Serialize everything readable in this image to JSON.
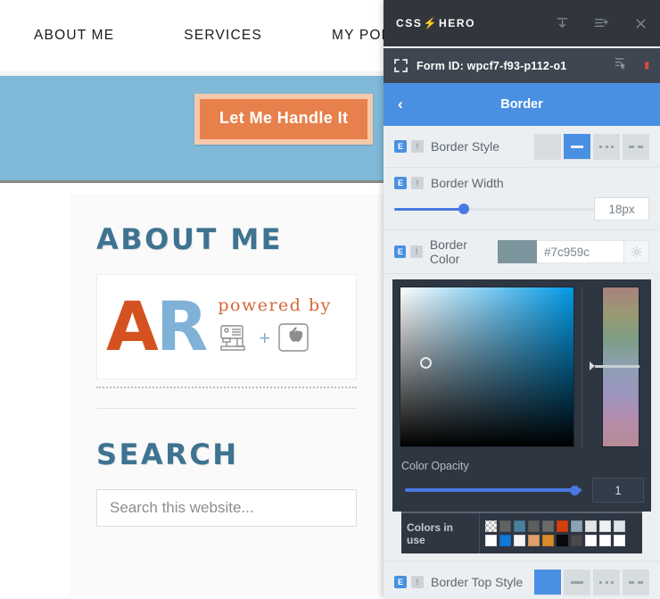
{
  "site": {
    "nav": [
      {
        "label": "ABOUT ME"
      },
      {
        "label": "SERVICES"
      },
      {
        "label": "MY PORTFOLIO"
      }
    ],
    "banner": {
      "cta_label": "Let Me Handle It",
      "bg_color": "#80bad8",
      "cta_color": "#e8804c"
    },
    "widgets": {
      "about": {
        "title": "ABOUT ME",
        "logo_a": "A",
        "logo_r": "R",
        "powered_by": "powered by",
        "plus": "+"
      },
      "search": {
        "title": "SEARCH",
        "placeholder": "Search this website...",
        "value": ""
      }
    }
  },
  "panel": {
    "brand": "CSS",
    "brand_bolt": "⚡",
    "brand_2": "HERO",
    "top_icons": [
      {
        "name": "save-icon"
      },
      {
        "name": "add-rule-icon"
      },
      {
        "name": "close-icon"
      }
    ],
    "selector": {
      "label": "Form ID: wpcf7-f93-p112-o1",
      "dot_color": "#e04a3a"
    },
    "section_title": "Border",
    "back_chevron": "‹",
    "controls": {
      "border_style": {
        "label": "Border Style",
        "options": [
          "none",
          "solid",
          "dotted",
          "dashed"
        ],
        "selected_index": 1
      },
      "border_width": {
        "label": "Border Width",
        "value": "18px",
        "percent": 35
      },
      "border_color": {
        "label": "Border Color",
        "value": "#7c959c",
        "swatch": "#7c959c"
      },
      "color_opacity": {
        "label": "Color Opacity",
        "value": "1",
        "percent": 100
      },
      "colors_in_use": {
        "label": "Colors in use",
        "swatches": [
          "transparent",
          "#626262",
          "#4b7f9c",
          "#5e5e5e",
          "#6b6b6b",
          "#d4400d",
          "#8ca3b4",
          "#e3e5e5",
          "#f0f2f2",
          "#dce5e8",
          "#ffffff",
          "#1179d4",
          "#f5f5f5",
          "#dda06a",
          "#d98a2b",
          "#0a0a0a",
          "#4a4a4a",
          "#ffffff",
          "#ffffff",
          "#ffffff"
        ]
      },
      "border_top_style": {
        "label": "Border Top Style",
        "options": [
          "none",
          "solid",
          "dotted",
          "dashed"
        ],
        "selected_index": 0
      }
    }
  }
}
